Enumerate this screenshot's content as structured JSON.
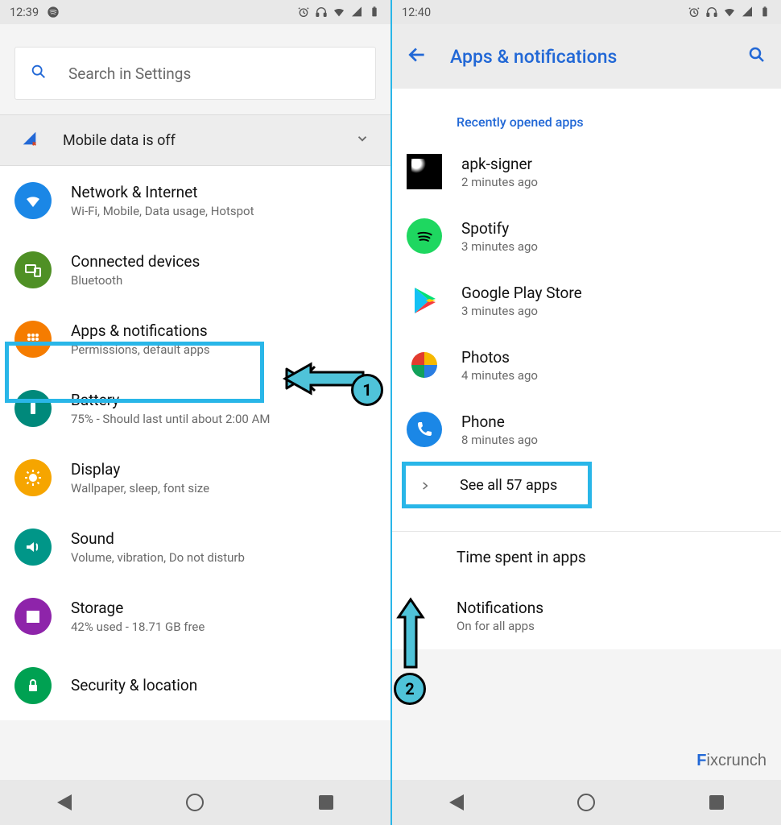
{
  "left": {
    "status": {
      "time": "12:39"
    },
    "search_placeholder": "Search in Settings",
    "mobile_data_label": "Mobile data is off",
    "items": [
      {
        "title": "Network & Internet",
        "sub": "Wi-Fi, Mobile, Data usage, Hotspot"
      },
      {
        "title": "Connected devices",
        "sub": "Bluetooth"
      },
      {
        "title": "Apps & notifications",
        "sub": "Permissions, default apps"
      },
      {
        "title": "Battery",
        "sub": "75% - Should last until about 2:00 AM"
      },
      {
        "title": "Display",
        "sub": "Wallpaper, sleep, font size"
      },
      {
        "title": "Sound",
        "sub": "Volume, vibration, Do not disturb"
      },
      {
        "title": "Storage",
        "sub": "42% used - 18.71 GB free"
      },
      {
        "title": "Security & location",
        "sub": ""
      }
    ]
  },
  "right": {
    "status": {
      "time": "12:40"
    },
    "header_title": "Apps & notifications",
    "section_label": "Recently opened apps",
    "apps": [
      {
        "name": "apk-signer",
        "time": "2 minutes ago"
      },
      {
        "name": "Spotify",
        "time": "3 minutes ago"
      },
      {
        "name": "Google Play Store",
        "time": "3 minutes ago"
      },
      {
        "name": "Photos",
        "time": "4 minutes ago"
      },
      {
        "name": "Phone",
        "time": "8 minutes ago"
      }
    ],
    "see_all": "See all 57 apps",
    "extra": [
      {
        "title": "Time spent in apps",
        "sub": ""
      },
      {
        "title": "Notifications",
        "sub": "On for all apps"
      }
    ]
  },
  "steps": {
    "one": "1",
    "two": "2"
  },
  "watermark_prefix": "F",
  "watermark_rest": "ixcrunch"
}
